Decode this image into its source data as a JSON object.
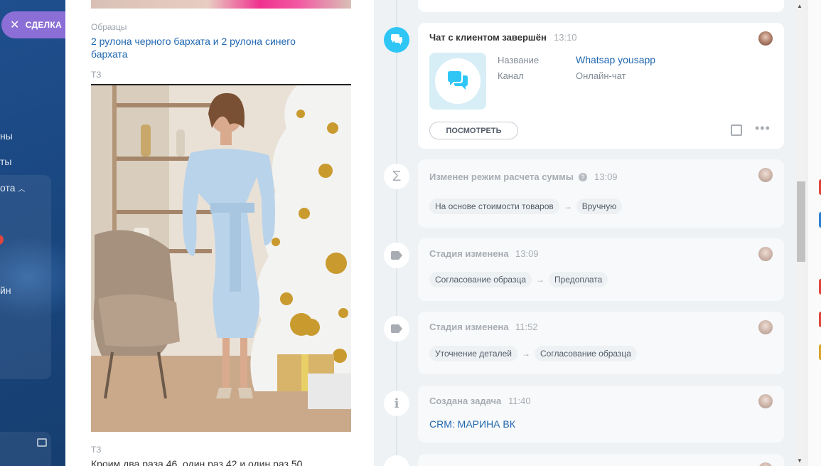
{
  "close_deal": {
    "icon": "close-icon",
    "label": "СДЕЛКА"
  },
  "left_sidebar": {
    "items": [
      "ны",
      "ты",
      "ота",
      "йн"
    ]
  },
  "fields": {
    "samples_label": "Образцы",
    "samples_value": "2 рулона черного бархата и 2 рулона синего бархата",
    "tz_label": "ТЗ",
    "tz2_label": "ТЗ",
    "tz2_value": "Кроим два раза 46, один раз 42 и один раз 50"
  },
  "timeline": {
    "chat": {
      "title": "Чат с клиентом завершён",
      "time": "13:10",
      "name_label": "Название",
      "name_value": "Whatsap yousapp",
      "channel_label": "Канал",
      "channel_value": "Онлайн-чат",
      "view_button": "ПОСМОТРЕТЬ"
    },
    "sum_mode": {
      "title": "Изменен режим расчета суммы",
      "time": "13:09",
      "from": "На основе стоимости товаров",
      "to": "Вручную"
    },
    "stage1": {
      "title": "Стадия изменена",
      "time": "13:09",
      "from": "Согласование образца",
      "to": "Предоплата"
    },
    "stage2": {
      "title": "Стадия изменена",
      "time": "11:52",
      "from": "Уточнение деталей",
      "to": "Согласование образца"
    },
    "task": {
      "title": "Создана задача",
      "time": "11:40",
      "link": "CRM: МАРИНА ВК"
    }
  },
  "colors": {
    "accent": "#2fc6f6",
    "link": "#2067b0",
    "purple_button": "#8b6fd6"
  }
}
